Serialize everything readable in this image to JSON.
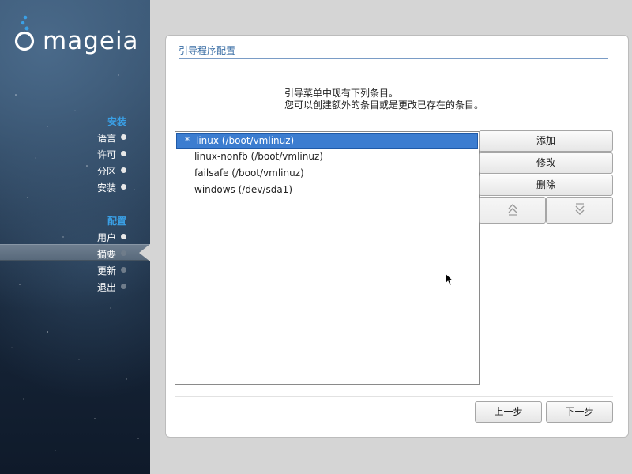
{
  "brand": {
    "name": "mageia"
  },
  "sidebar": {
    "sections": [
      {
        "title": "安装"
      },
      {
        "title": "配置"
      }
    ],
    "items": [
      {
        "label": "语言",
        "state": "done"
      },
      {
        "label": "许可",
        "state": "done"
      },
      {
        "label": "分区",
        "state": "done"
      },
      {
        "label": "安装",
        "state": "done"
      },
      {
        "label": "用户",
        "state": "done"
      },
      {
        "label": "摘要",
        "state": "current"
      },
      {
        "label": "更新",
        "state": "pending"
      },
      {
        "label": "退出",
        "state": "pending"
      }
    ]
  },
  "panel": {
    "title": "引导程序配置",
    "intro_line1": "引导菜单中现有下列条目。",
    "intro_line2": "您可以创建额外的条目或是更改已存在的条目。"
  },
  "entries": [
    {
      "marker": "*",
      "text": "linux (/boot/vmlinuz)",
      "selected": true
    },
    {
      "marker": "",
      "text": "linux-nonfb (/boot/vmlinuz)",
      "selected": false
    },
    {
      "marker": "",
      "text": "failsafe (/boot/vmlinuz)",
      "selected": false
    },
    {
      "marker": "",
      "text": "windows (/dev/sda1)",
      "selected": false
    }
  ],
  "buttons": {
    "add": "添加",
    "modify": "修改",
    "remove": "删除",
    "move_up_icon": "double-chevron-up-icon",
    "move_down_icon": "double-chevron-down-icon",
    "previous": "上一步",
    "next": "下一步"
  },
  "colors": {
    "accent": "#3aa0e6",
    "selection": "#3c7dd0",
    "title": "#3a6ea5"
  }
}
